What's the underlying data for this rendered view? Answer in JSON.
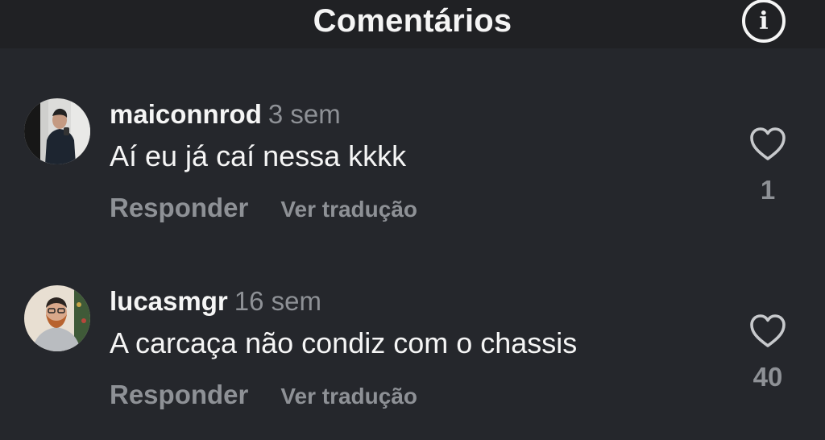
{
  "header": {
    "title": "Comentários",
    "info_icon": "info-icon",
    "info_glyph": "i"
  },
  "comments": [
    {
      "username": "maiconnrod",
      "time": "3 sem",
      "text": "Aí eu já caí nessa kkkk",
      "reply_label": "Responder",
      "translate_label": "Ver tradução",
      "likes": "1",
      "like_icon": "heart-outline-icon"
    },
    {
      "username": "lucasmgr",
      "time": "16 sem",
      "text": "A carcaça não condiz com o chassis",
      "reply_label": "Responder",
      "translate_label": "Ver tradução",
      "likes": "40",
      "like_icon": "heart-outline-icon"
    }
  ],
  "colors": {
    "background": "#25272c",
    "header_background": "#202124",
    "primary_text": "#f5f5f5",
    "secondary_text": "#8e9196"
  }
}
